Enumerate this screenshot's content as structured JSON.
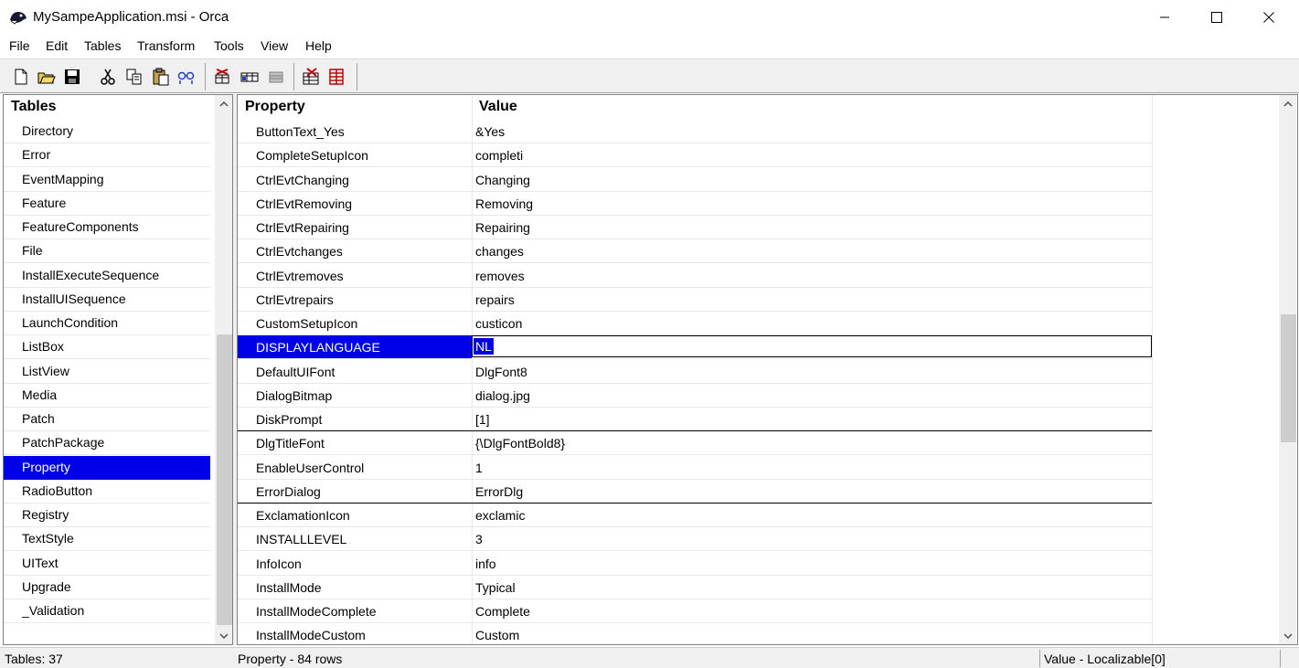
{
  "window": {
    "title": "MySampeApplication.msi - Orca",
    "minimize_glyph": "—",
    "maximize_glyph": "☐",
    "close_glyph": "✕"
  },
  "menu": [
    "File",
    "Edit",
    "Tables",
    "Transform",
    "Tools",
    "View",
    "Help"
  ],
  "toolbar": {
    "icons": [
      "new-icon",
      "open-icon",
      "save-icon",
      "cut-icon",
      "copy-icon",
      "paste-icon",
      "find-icon",
      "validate-icon",
      "tables-icon",
      "merge-icon",
      "transform-icon",
      "compare-icon"
    ]
  },
  "tables_pane": {
    "header": "Tables",
    "items": [
      "Directory",
      "Error",
      "EventMapping",
      "Feature",
      "FeatureComponents",
      "File",
      "InstallExecuteSequence",
      "InstallUISequence",
      "LaunchCondition",
      "ListBox",
      "ListView",
      "Media",
      "Patch",
      "PatchPackage",
      "Property",
      "RadioButton",
      "Registry",
      "TextStyle",
      "UIText",
      "Upgrade",
      "_Validation"
    ],
    "selected": "Property"
  },
  "grid": {
    "columns": [
      "Property",
      "Value"
    ],
    "rows": [
      [
        "ButtonText_Yes",
        "&Yes"
      ],
      [
        "CompleteSetupIcon",
        "completi"
      ],
      [
        "CtrlEvtChanging",
        "Changing"
      ],
      [
        "CtrlEvtRemoving",
        "Removing"
      ],
      [
        "CtrlEvtRepairing",
        "Repairing"
      ],
      [
        "CtrlEvtchanges",
        "changes"
      ],
      [
        "CtrlEvtremoves",
        "removes"
      ],
      [
        "CtrlEvtrepairs",
        "repairs"
      ],
      [
        "CustomSetupIcon",
        "custicon"
      ],
      [
        "DISPLAYLANGUAGE",
        "NL"
      ],
      [
        "DefaultUIFont",
        "DlgFont8"
      ],
      [
        "DialogBitmap",
        "dialog.jpg"
      ],
      [
        "DiskPrompt",
        "[1]"
      ],
      [
        "DlgTitleFont",
        "{\\DlgFontBold8}"
      ],
      [
        "EnableUserControl",
        "1"
      ],
      [
        "ErrorDialog",
        "ErrorDlg"
      ],
      [
        "ExclamationIcon",
        "exclamic"
      ],
      [
        "INSTALLLEVEL",
        "3"
      ],
      [
        "InfoIcon",
        "info"
      ],
      [
        "InstallMode",
        "Typical"
      ],
      [
        "InstallModeComplete",
        "Complete"
      ],
      [
        "InstallModeCustom",
        "Custom"
      ]
    ],
    "selected_property": "DISPLAYLANGUAGE",
    "editing_value": "NL"
  },
  "status": {
    "tables_count": "Tables: 37",
    "table_info": "Property - 84 rows",
    "column_info": "Value - Localizable[0]"
  },
  "colors": {
    "selection": "#0000e8",
    "chrome": "#f0f0f0",
    "gridline": "#e8e8e8"
  }
}
